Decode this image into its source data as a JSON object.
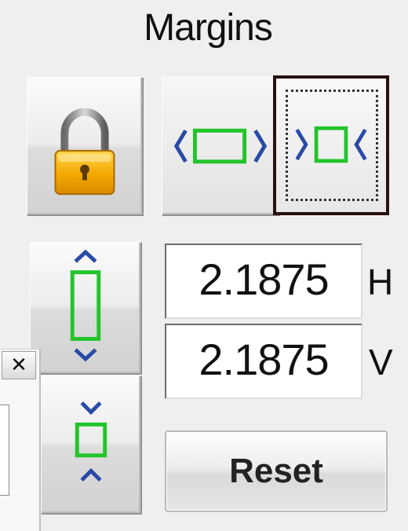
{
  "panel": {
    "title": "Margins",
    "horizontal": {
      "value": "2.1875",
      "label": "H"
    },
    "vertical": {
      "value": "2.1875",
      "label": "V"
    },
    "reset_label": "Reset"
  },
  "side_window": {
    "close_label": "✕"
  },
  "icons": {
    "lock": "lock-icon",
    "margin_expand_horizontal": "expand-horizontal-icon",
    "margin_shrink_horizontal": "shrink-horizontal-icon",
    "margin_expand_vertical": "expand-vertical-icon",
    "margin_shrink_vertical": "shrink-vertical-icon"
  },
  "colors": {
    "frame_green": "#22c42a",
    "arrow_blue": "#2a4aa8",
    "lock_gold": "#f4b400",
    "selected_border": "#2a1010"
  }
}
